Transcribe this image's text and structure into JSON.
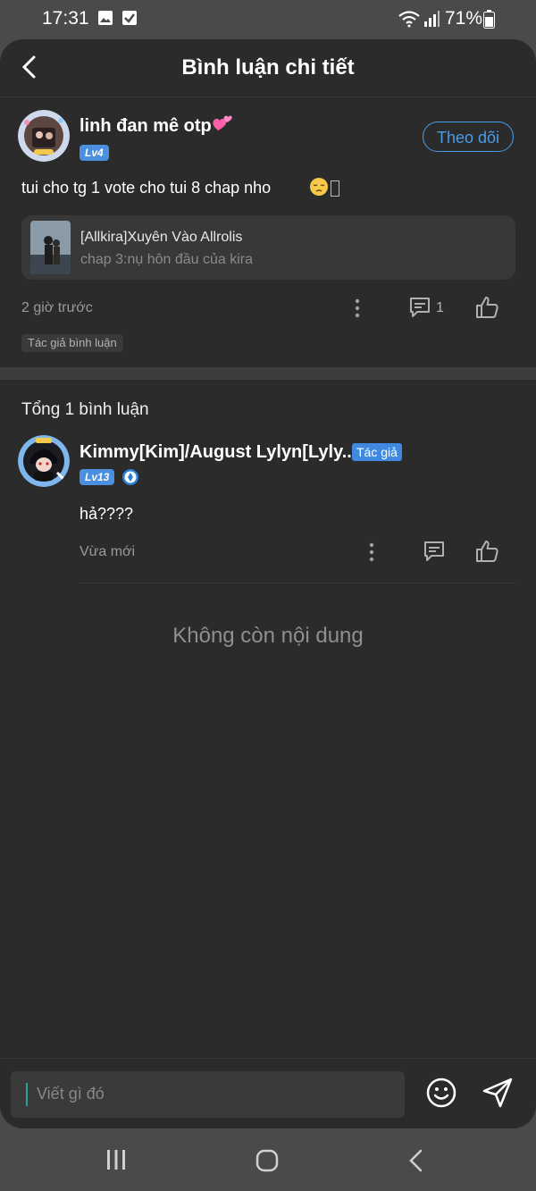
{
  "status_bar": {
    "time": "17:31",
    "battery": "71%"
  },
  "header": {
    "title": "Bình luận chi tiết"
  },
  "main_comment": {
    "user_name": "linh đan mê otp",
    "level": "Lv4",
    "follow_label": "Theo dõi",
    "text": "tui cho tg 1 vote cho tui 8 chap nho",
    "story": {
      "title": "[Allkira]Xuyên Vào Allrolis",
      "chapter": "chap 3:nụ hôn đầu của kira"
    },
    "time": "2 giờ trước",
    "reply_count": "1",
    "author_tag": "Tác giả bình luận"
  },
  "replies": {
    "total_label": "Tổng 1 bình luận",
    "items": [
      {
        "user_name": "Kimmy[Kim]/August Lylyn[Lyly...",
        "badge": "Tác giả",
        "level": "Lv13",
        "text": "hả????",
        "time": "Vừa mới"
      }
    ],
    "end_label": "Không còn nội dung"
  },
  "composer": {
    "placeholder": "Viết gì đó"
  },
  "colors": {
    "accent": "#4a9be8",
    "background": "#2b2b2b",
    "badge": "#3f8ae0"
  }
}
